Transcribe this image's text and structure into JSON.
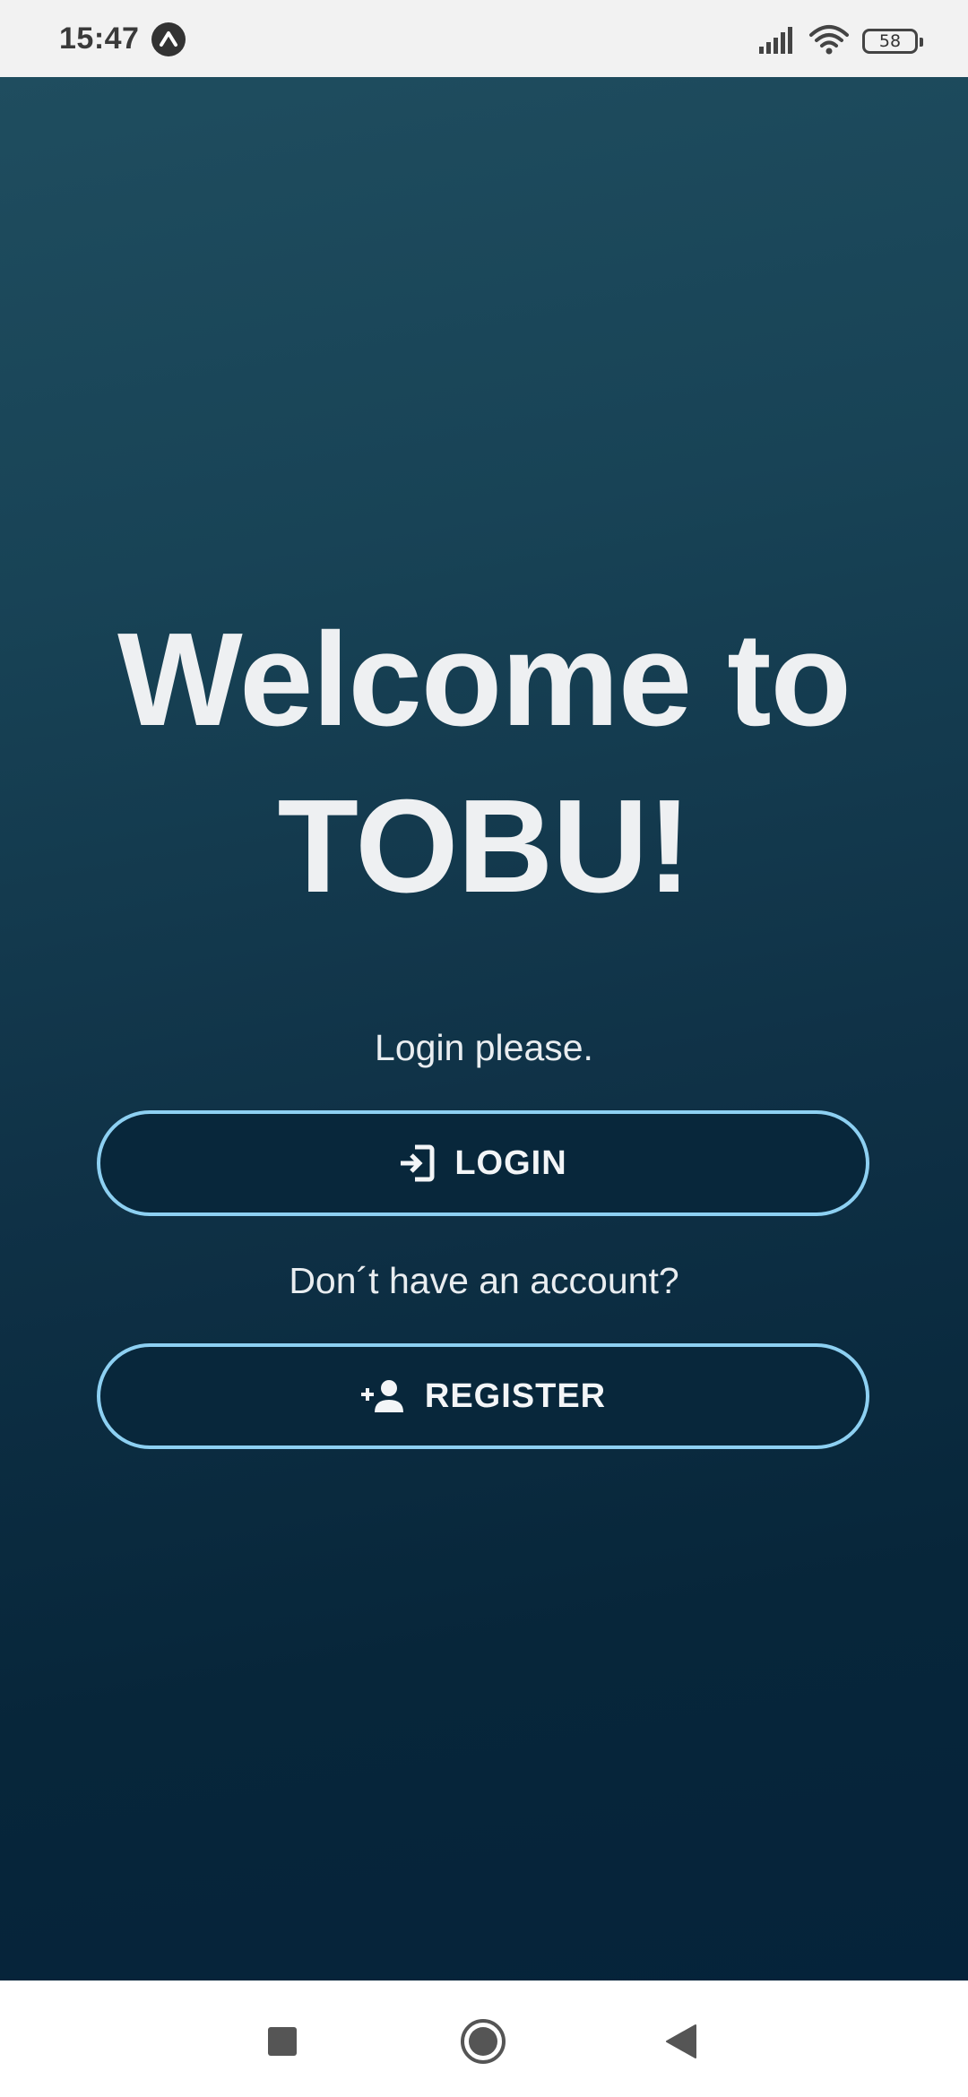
{
  "status_bar": {
    "time": "15:47",
    "battery_level": "58",
    "icons": [
      "expo-icon",
      "signal-icon",
      "wifi-icon",
      "battery-icon"
    ]
  },
  "welcome": {
    "title_line1": "Welcome to",
    "title_line2": "TOBU!"
  },
  "login": {
    "prompt": "Login please.",
    "button_label": "LOGIN",
    "icon": "login-icon"
  },
  "register": {
    "prompt": "Don´t have an account?",
    "button_label": "REGISTER",
    "icon": "person-add-icon"
  },
  "navigation": {
    "icons": [
      "recents-square-icon",
      "home-circle-icon",
      "back-triangle-icon"
    ]
  },
  "colors": {
    "gradient_top": "#1f4d5f",
    "gradient_bottom": "#05233a",
    "button_border": "#8dd0f2",
    "button_fill": "#08273b",
    "text": "#eef0f2"
  }
}
